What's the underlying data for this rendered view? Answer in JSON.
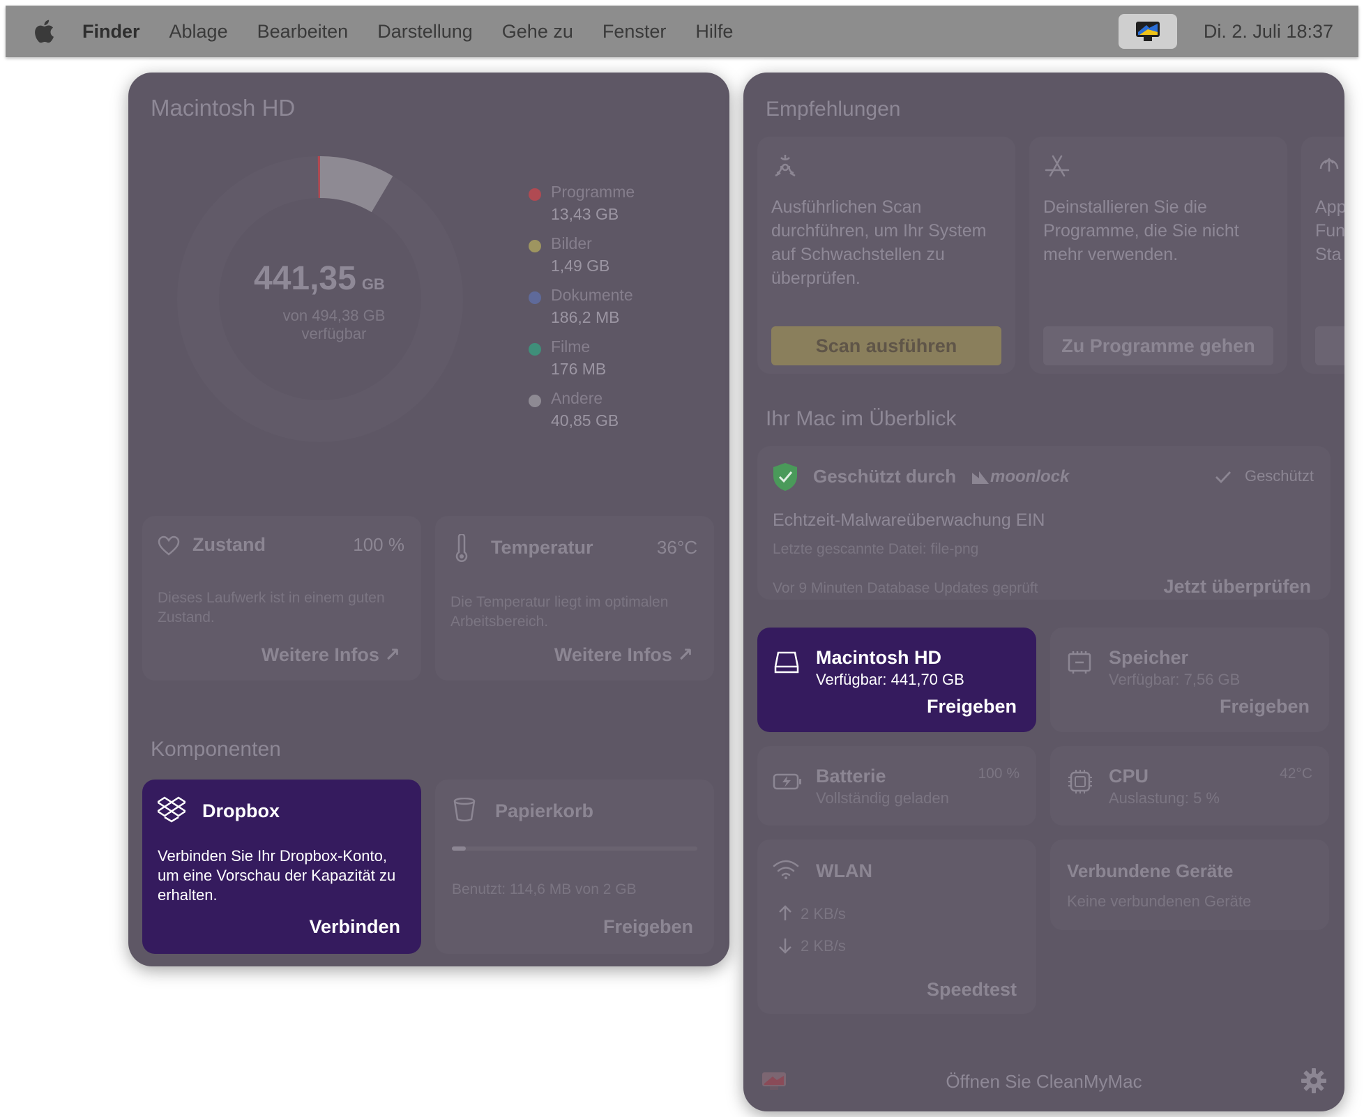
{
  "menubar": {
    "app_name": "Finder",
    "items": [
      "Ablage",
      "Bearbeiten",
      "Darstellung",
      "Gehe zu",
      "Fenster",
      "Hilfe"
    ],
    "clock": "Di. 2. Juli   18:37"
  },
  "disk": {
    "title": "Macintosh HD",
    "available_value": "441,35",
    "available_unit": "GB",
    "of_total": "von 494,38 GB",
    "available_label": "verfügbar",
    "legend": [
      {
        "name": "Programme",
        "value": "13,43 GB",
        "color": "#b04a52"
      },
      {
        "name": "Bilder",
        "value": "1,49 GB",
        "color": "#9e9560"
      },
      {
        "name": "Dokumente",
        "value": "186,2 MB",
        "color": "#5f6a9a"
      },
      {
        "name": "Filme",
        "value": "176 MB",
        "color": "#3f8f7a"
      },
      {
        "name": "Andere",
        "value": "40,85 GB",
        "color": "#8e8a93"
      }
    ]
  },
  "health": {
    "title": "Zustand",
    "value": "100 %",
    "description": "Dieses Laufwerk ist in einem guten Zustand.",
    "link": "Weitere Infos ↗"
  },
  "temperature": {
    "title": "Temperatur",
    "value": "36°C",
    "description": "Die Temperatur liegt im optimalen Arbeitsbereich.",
    "link": "Weitere Infos ↗"
  },
  "components": {
    "title": "Komponenten",
    "dropbox": {
      "title": "Dropbox",
      "description": "Verbinden Sie Ihr Dropbox-Konto, um eine Vorschau der Kapazität zu erhalten.",
      "action": "Verbinden"
    },
    "trash": {
      "title": "Papierkorb",
      "usage": "Benutzt: 114,6 MB von 2 GB",
      "usage_fraction": 0.057,
      "action": "Freigeben"
    }
  },
  "recommendations": {
    "title": "Empfehlungen",
    "cards": [
      {
        "text": "Ausführlichen Scan durchführen, um Ihr System auf Schwachstellen zu überprüfen.",
        "button": "Scan ausführen",
        "icon": "biohazard-icon"
      },
      {
        "text": "Deinstallieren Sie die Programme, die Sie nicht mehr verwenden.",
        "button": "Zu Programme gehen",
        "icon": "app-store-icon"
      },
      {
        "text": "App Fun Sta",
        "button": "",
        "icon": "update-icon"
      }
    ]
  },
  "overview": {
    "title": "Ihr Mac im Überblick",
    "protection": {
      "title": "Geschützt durch",
      "brand": "moonlock",
      "status": "Geschützt",
      "realtime": "Echtzeit-Malwareüberwachung EIN",
      "last_file": "Letzte gescannte Datei: file-png",
      "db_update": "Vor 9 Minuten Database Updates geprüft",
      "check_action": "Jetzt überprüfen"
    },
    "disk_tile": {
      "title": "Macintosh HD",
      "subtitle": "Verfügbar: 441,70 GB",
      "action": "Freigeben"
    },
    "memory_tile": {
      "title": "Speicher",
      "subtitle": "Verfügbar: 7,56 GB",
      "action": "Freigeben"
    },
    "battery_tile": {
      "title": "Batterie",
      "subtitle": "Vollständig geladen",
      "value": "100 %"
    },
    "cpu_tile": {
      "title": "CPU",
      "subtitle": "Auslastung: 5 %",
      "value": "42°C"
    },
    "wifi_tile": {
      "title": "WLAN",
      "upload": "2 KB/s",
      "download": "2 KB/s",
      "action": "Speedtest"
    },
    "devices_tile": {
      "title": "Verbundene Geräte",
      "subtitle": "Keine verbundenen Geräte"
    }
  },
  "footer": {
    "open_label": "Öffnen Sie CleanMyMac"
  }
}
